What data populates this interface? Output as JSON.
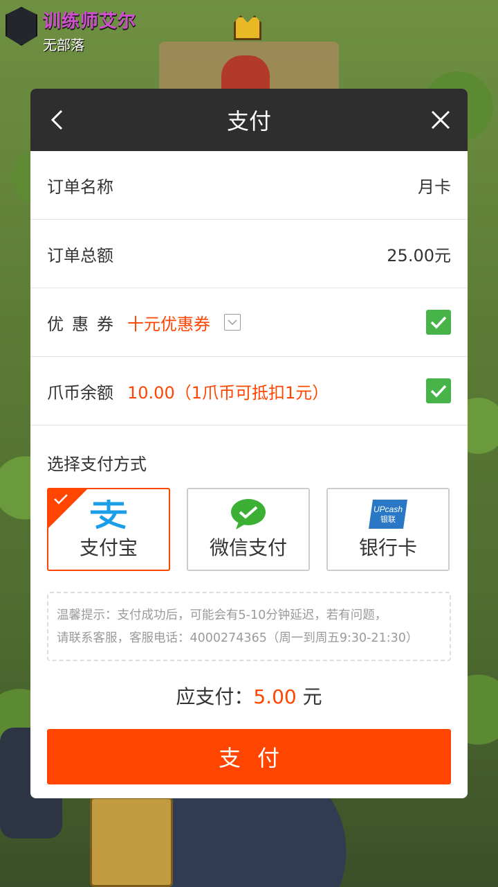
{
  "hud": {
    "player_name": "训练师艾尔",
    "clan": "无部落"
  },
  "modal": {
    "title": "支付",
    "order_name_label": "订单名称",
    "order_name_value": "月卡",
    "order_total_label": "订单总额",
    "order_total_value": "25.00元",
    "coupon_label": "优惠券",
    "coupon_value": "十元优惠券",
    "coin_label": "爪币余额",
    "coin_value": "10.00（1爪币可抵扣1元）",
    "method_title": "选择支付方式",
    "methods": [
      {
        "label": "支付宝",
        "icon": "alipay-icon",
        "selected": true
      },
      {
        "label": "微信支付",
        "icon": "wechat-pay-icon",
        "selected": false
      },
      {
        "label": "银行卡",
        "icon": "unionpay-icon",
        "selected": false
      }
    ],
    "tip_line1": "温馨提示：支付成功后，可能会有5-10分钟延迟，若有问题，",
    "tip_line2": "请联系客服，客服电话：4000274365（周一到周五9:30-21:30）",
    "pay_prefix": "应支付：",
    "pay_amount": "5.00",
    "pay_suffix": " 元",
    "pay_button": "支付"
  },
  "colors": {
    "accent": "#ff4500",
    "check": "#46b449",
    "header": "#000000"
  }
}
